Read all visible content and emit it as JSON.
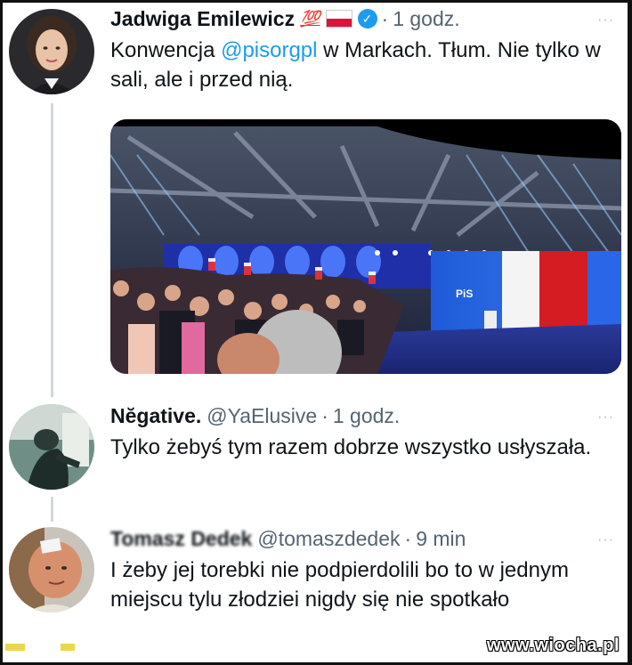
{
  "tweets": [
    {
      "name": "Jadwiga Emilewicz",
      "badge": "💯",
      "time": "1 godz.",
      "more": "···",
      "text_before": "Konwencja ",
      "mention": "@pisorgpl",
      "text_after": " w Markach. Tłum. Nie tylko w sali, ale i przed nią.",
      "verified": "✓"
    },
    {
      "name": "Nĕgative.",
      "handle": "@YaElusive",
      "time": "1 godz.",
      "more": "···",
      "text": "Tylko żebyś tym razem dobrze wszystko usłyszała."
    },
    {
      "name": "Tomasz Dedek",
      "handle": "@tomaszdedek",
      "time": "9 min",
      "more": "···",
      "text": "I żeby jej torebki nie podpierdolili bo to w jednym miejscu tylu złodziei nigdy się nie spotkało"
    }
  ],
  "separator": "·",
  "watermark": "www.wiocha.pl",
  "colors": {
    "mention": "#1d9bf0",
    "verified": "#1d9bf0",
    "flag_red": "#dc143c",
    "thread_line": "#cfd9de"
  }
}
